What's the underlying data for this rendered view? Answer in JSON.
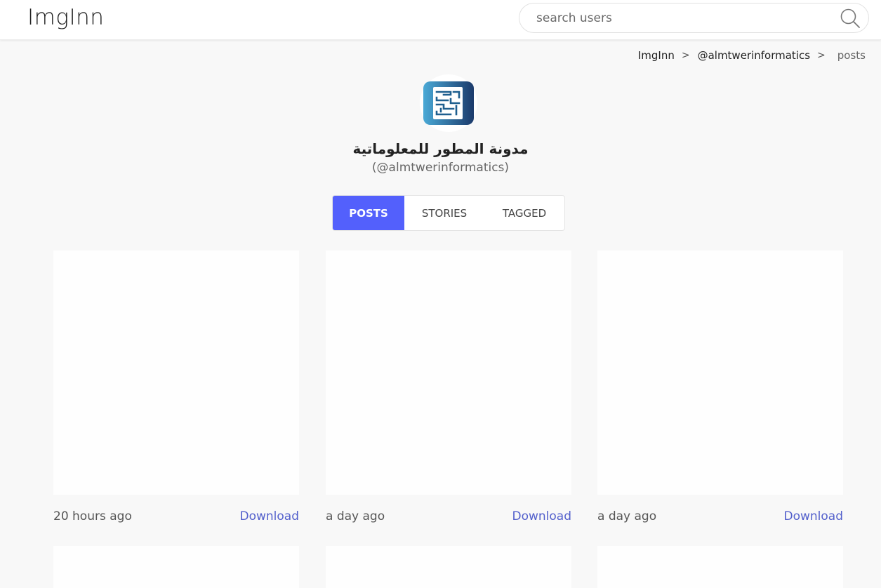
{
  "header": {
    "logo": "ImgInn",
    "search_placeholder": "search users"
  },
  "breadcrumb": {
    "home": "ImgInn",
    "sep1": ">",
    "user": "@almtwerinformatics",
    "sep2": ">",
    "current": "posts"
  },
  "profile": {
    "name": "مدونة المطور للمعلوماتية",
    "handle": "(@almtwerinformatics)",
    "avatar_colors": {
      "start": "#4aa9d6",
      "end": "#1b3a6b"
    }
  },
  "tabs": [
    {
      "label": "POSTS",
      "active": true
    },
    {
      "label": "STORIES",
      "active": false
    },
    {
      "label": "TAGGED",
      "active": false
    }
  ],
  "posts": [
    {
      "time": "20 hours ago",
      "action": "Download"
    },
    {
      "time": "a day ago",
      "action": "Download"
    },
    {
      "time": "a day ago",
      "action": "Download"
    }
  ],
  "colors": {
    "accent": "#5360fc",
    "link": "#5360cc",
    "background": "#f8f8f8"
  }
}
